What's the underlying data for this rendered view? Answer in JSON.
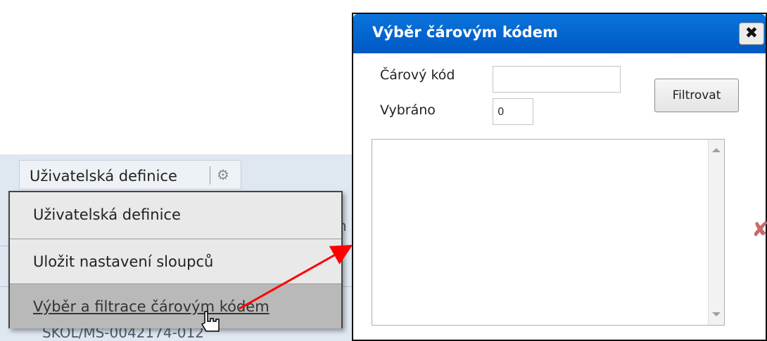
{
  "toolbar": {
    "button_label": "Uživatelská definice",
    "icon": "gear-icon"
  },
  "menu": {
    "items": [
      {
        "label": "Uživatelská definice"
      },
      {
        "label": "Uložit nastavení sloupců"
      },
      {
        "label": "Výběr a filtrace čárovým kódem"
      }
    ]
  },
  "background": {
    "partial_text": "SKOL/MS-0042174-012",
    "partial_char": "n"
  },
  "dialog": {
    "title": "Výběr čárovým kódem",
    "close_label": "✖",
    "barcode_label": "Čárový kód",
    "barcode_value": "",
    "selected_label": "Vybráno",
    "selected_value": "0",
    "filter_button": "Filtrovat",
    "clear_icon": "x-icon"
  },
  "colors": {
    "title_bar": "#0a74db",
    "arrow": "#ff0000",
    "menu_hover": "#b9b9b9"
  }
}
